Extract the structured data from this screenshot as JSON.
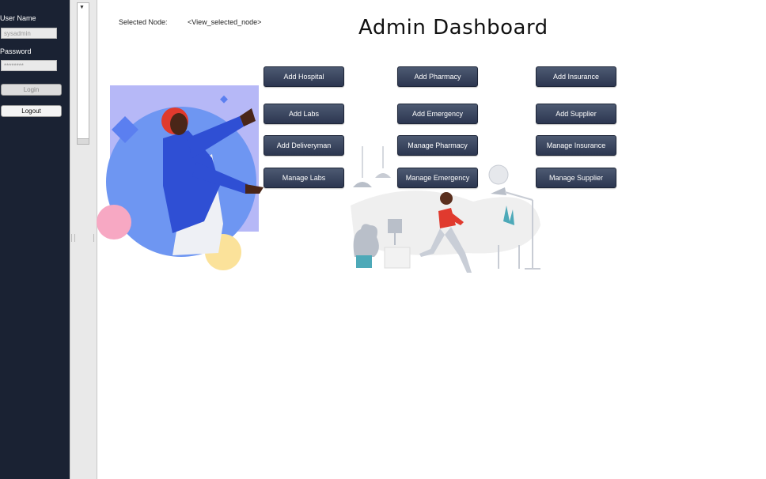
{
  "login": {
    "username_label": "User Name",
    "username_value": "sysadmin",
    "password_label": "Password",
    "password_value": "********",
    "login_button": "Login",
    "logout_button": "Logout"
  },
  "tree": {
    "toggle_glyph": "▼"
  },
  "header": {
    "selected_node_label": "Selected Node:",
    "selected_node_value": "<View_selected_node>",
    "title": "Admin Dashboard"
  },
  "buttons": {
    "add_hospital": "Add Hospital",
    "add_pharmacy": "Add Pharmacy",
    "add_insurance": "Add Insurance",
    "add_labs": "Add Labs",
    "add_emergency": "Add Emergency",
    "add_supplier": "Add Supplier",
    "add_deliveryman": "Add Deliveryman",
    "manage_pharmacy": "Manage Pharmacy",
    "manage_insurance": "Manage Insurance",
    "manage_labs": "Manage Labs",
    "manage_emergency": "Manage Emergency",
    "manage_supplier": "Manage Supplier"
  },
  "colors": {
    "sidebar_bg": "#1a2233",
    "button_bg": "#2c3650",
    "accent_blue": "#6e96f2",
    "accent_red": "#e03a2e"
  }
}
